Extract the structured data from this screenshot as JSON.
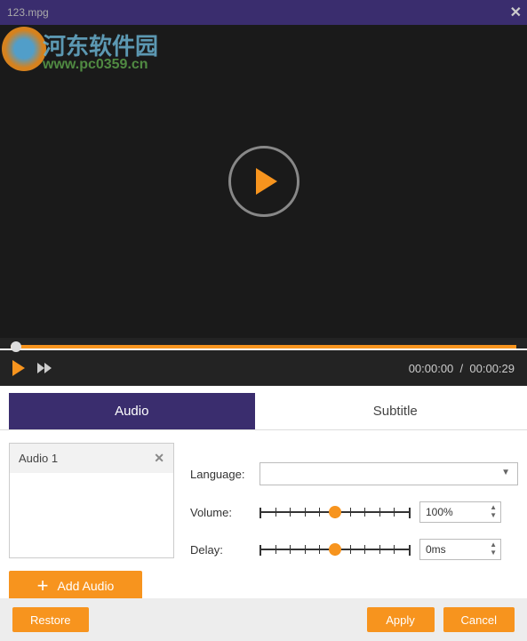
{
  "titlebar": {
    "filename": "123.mpg"
  },
  "watermark": {
    "text": "河东软件园",
    "url": "www.pc0359.cn"
  },
  "player": {
    "current_time": "00:00:00",
    "total_time": "00:00:29",
    "separator": "/"
  },
  "tabs": {
    "audio": "Audio",
    "subtitle": "Subtitle"
  },
  "audio_list": {
    "items": [
      {
        "label": "Audio 1"
      }
    ],
    "add_button": "Add Audio"
  },
  "settings": {
    "language_label": "Language:",
    "language_value": "",
    "volume_label": "Volume:",
    "volume_value": "100%",
    "volume_percent": 50,
    "delay_label": "Delay:",
    "delay_value": "0ms",
    "delay_percent": 50
  },
  "footer": {
    "restore": "Restore",
    "apply": "Apply",
    "cancel": "Cancel"
  },
  "chart_data": {
    "type": "table",
    "title": "Audio track settings",
    "rows": [
      {
        "field": "Language",
        "value": ""
      },
      {
        "field": "Volume",
        "value": "100%"
      },
      {
        "field": "Delay",
        "value": "0ms"
      }
    ],
    "playback": {
      "position": "00:00:00",
      "duration": "00:00:29"
    }
  }
}
